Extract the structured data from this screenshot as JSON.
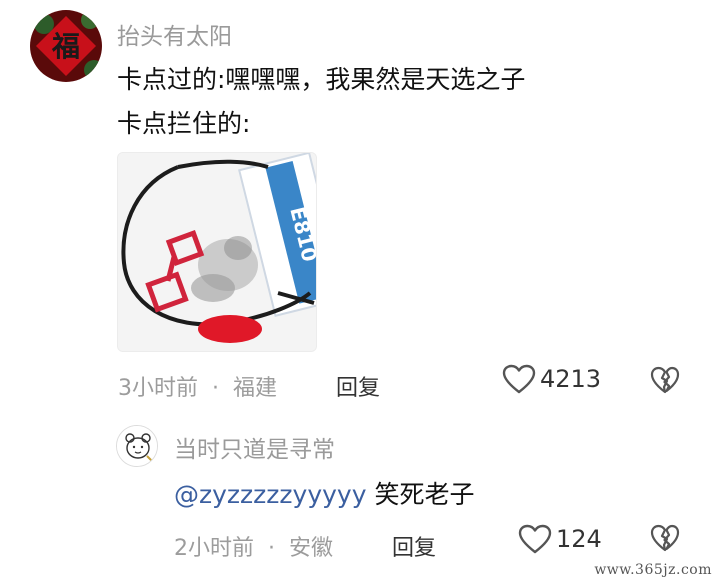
{
  "comment": {
    "author": "抬头有太阳",
    "avatar_glyph": "福",
    "lines": [
      "卡点过的:嘿嘿嘿，我果然是天选之子",
      "卡点拦住的:"
    ],
    "meme_text": "E810",
    "time": "3小时前",
    "location": "福建",
    "reply_label": "回复",
    "likes": "4213"
  },
  "reply": {
    "author": "当时只道是寻常",
    "mention": "@zyzzzzzyyyyy",
    "text": " 笑死老子",
    "time": "2小时前",
    "location": "安徽",
    "reply_label": "回复",
    "likes": "124"
  },
  "separator": "·",
  "watermark": "www.365jz.com",
  "colors": {
    "text": "#111111",
    "meta": "#9c9c9c",
    "mention": "#3b5fa0",
    "avatar_red": "#c8101a"
  }
}
